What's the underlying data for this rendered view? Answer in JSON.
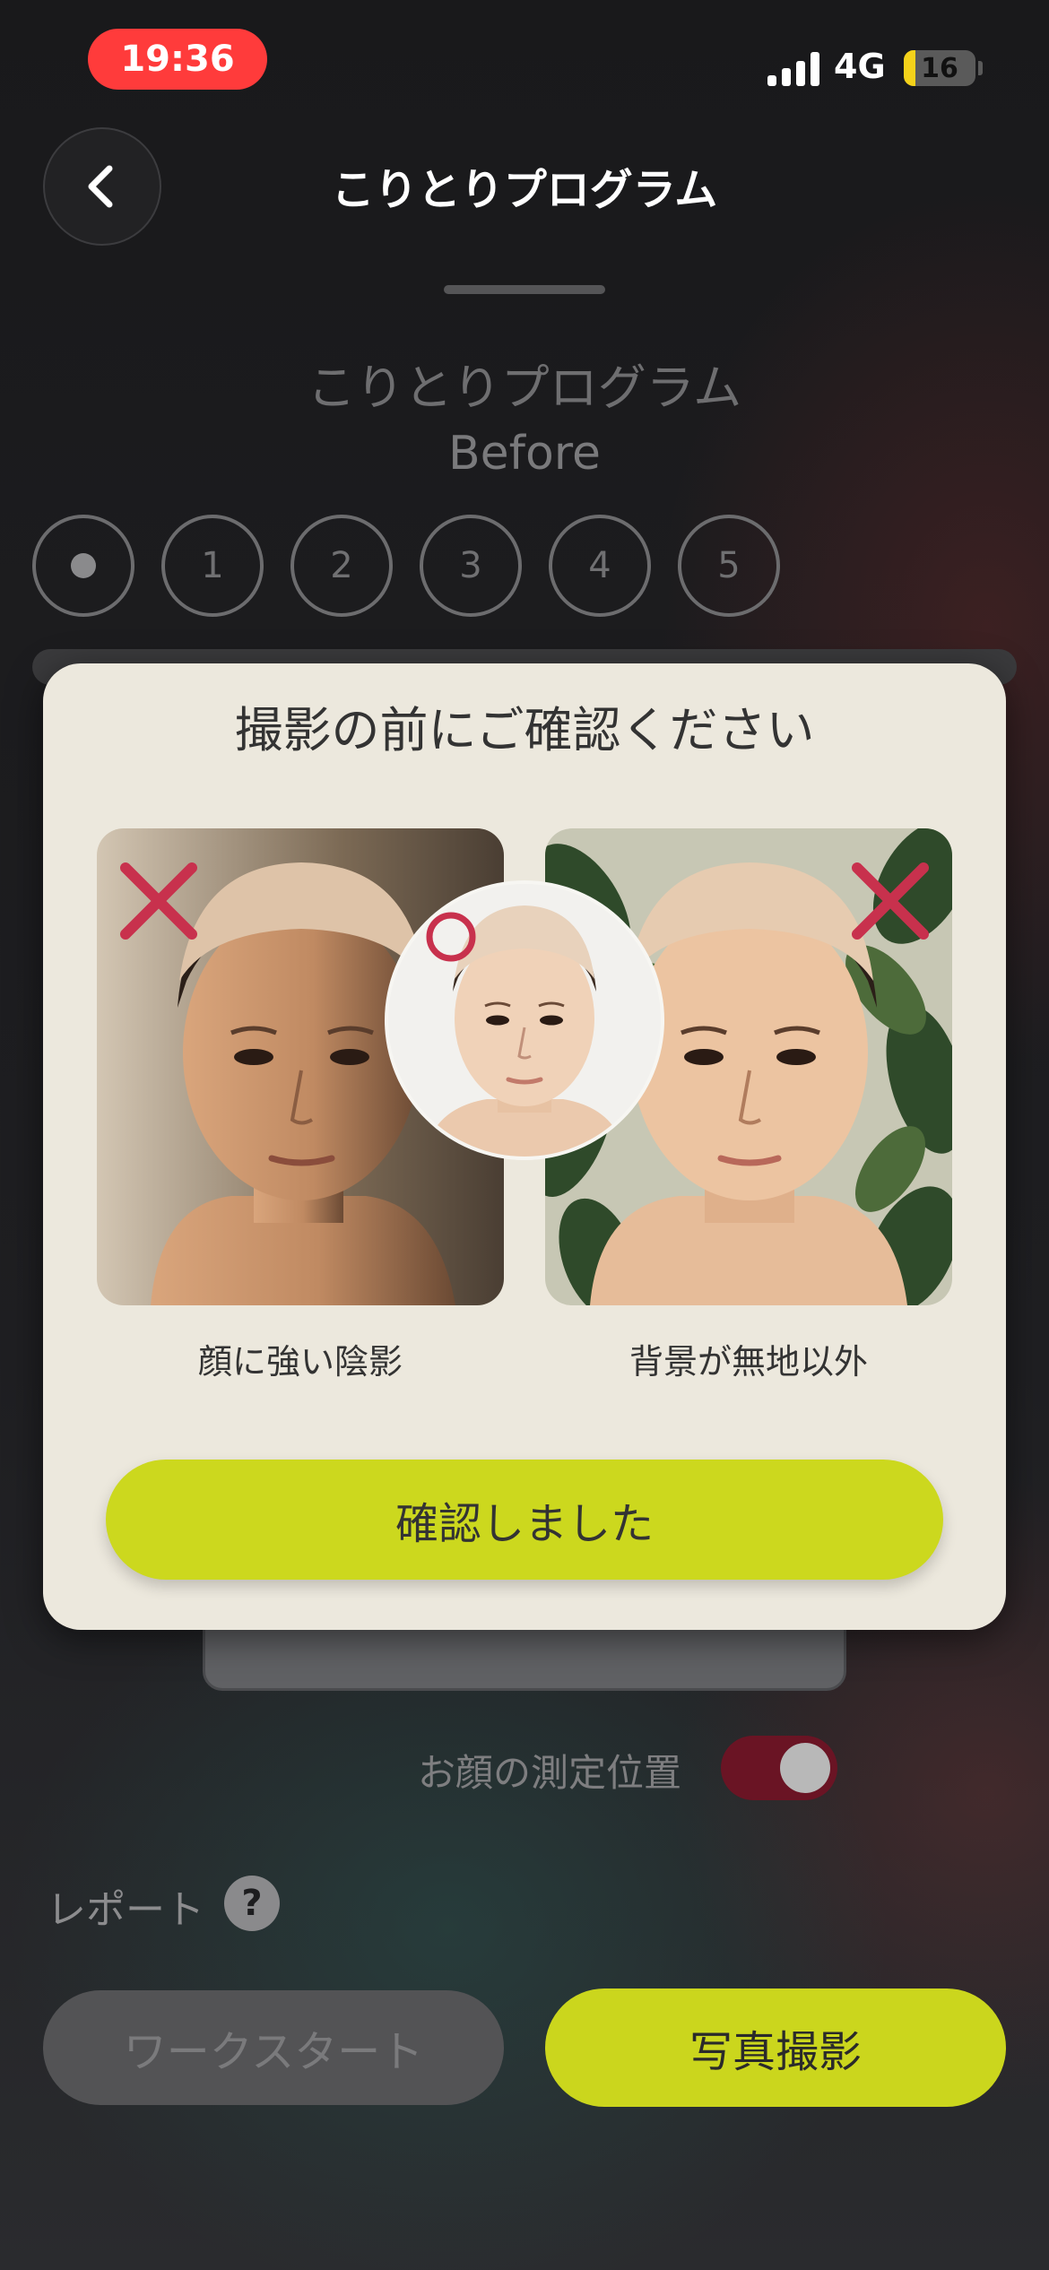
{
  "status_bar": {
    "time": "19:36",
    "network": "4G",
    "battery": "16"
  },
  "header": {
    "title": "こりとりプログラム"
  },
  "page": {
    "program_title": "こりとりプログラム",
    "phase_label": "Before",
    "steps": [
      "1",
      "2",
      "3",
      "4",
      "5"
    ],
    "face_position_label": "お顔の測定位置",
    "report_label": "レポート",
    "help_symbol": "?",
    "work_start_label": "ワークスタート",
    "photo_button_label": "写真撮影"
  },
  "modal": {
    "title": "撮影の前にご確認ください",
    "caption_left": "顔に強い陰影",
    "caption_right": "背景が無地以外",
    "confirm_label": "確認しました"
  },
  "colors": {
    "accent": "#ccd81e",
    "status_time_bg": "#ff3b3b",
    "mark_red": "#c8314d",
    "toggle_track": "#6a1424",
    "modal_bg": "#ece8dd"
  },
  "icons": {
    "back": "chevron-left-icon",
    "wrong": "cross-icon",
    "correct": "circle-icon",
    "help": "question-icon"
  }
}
